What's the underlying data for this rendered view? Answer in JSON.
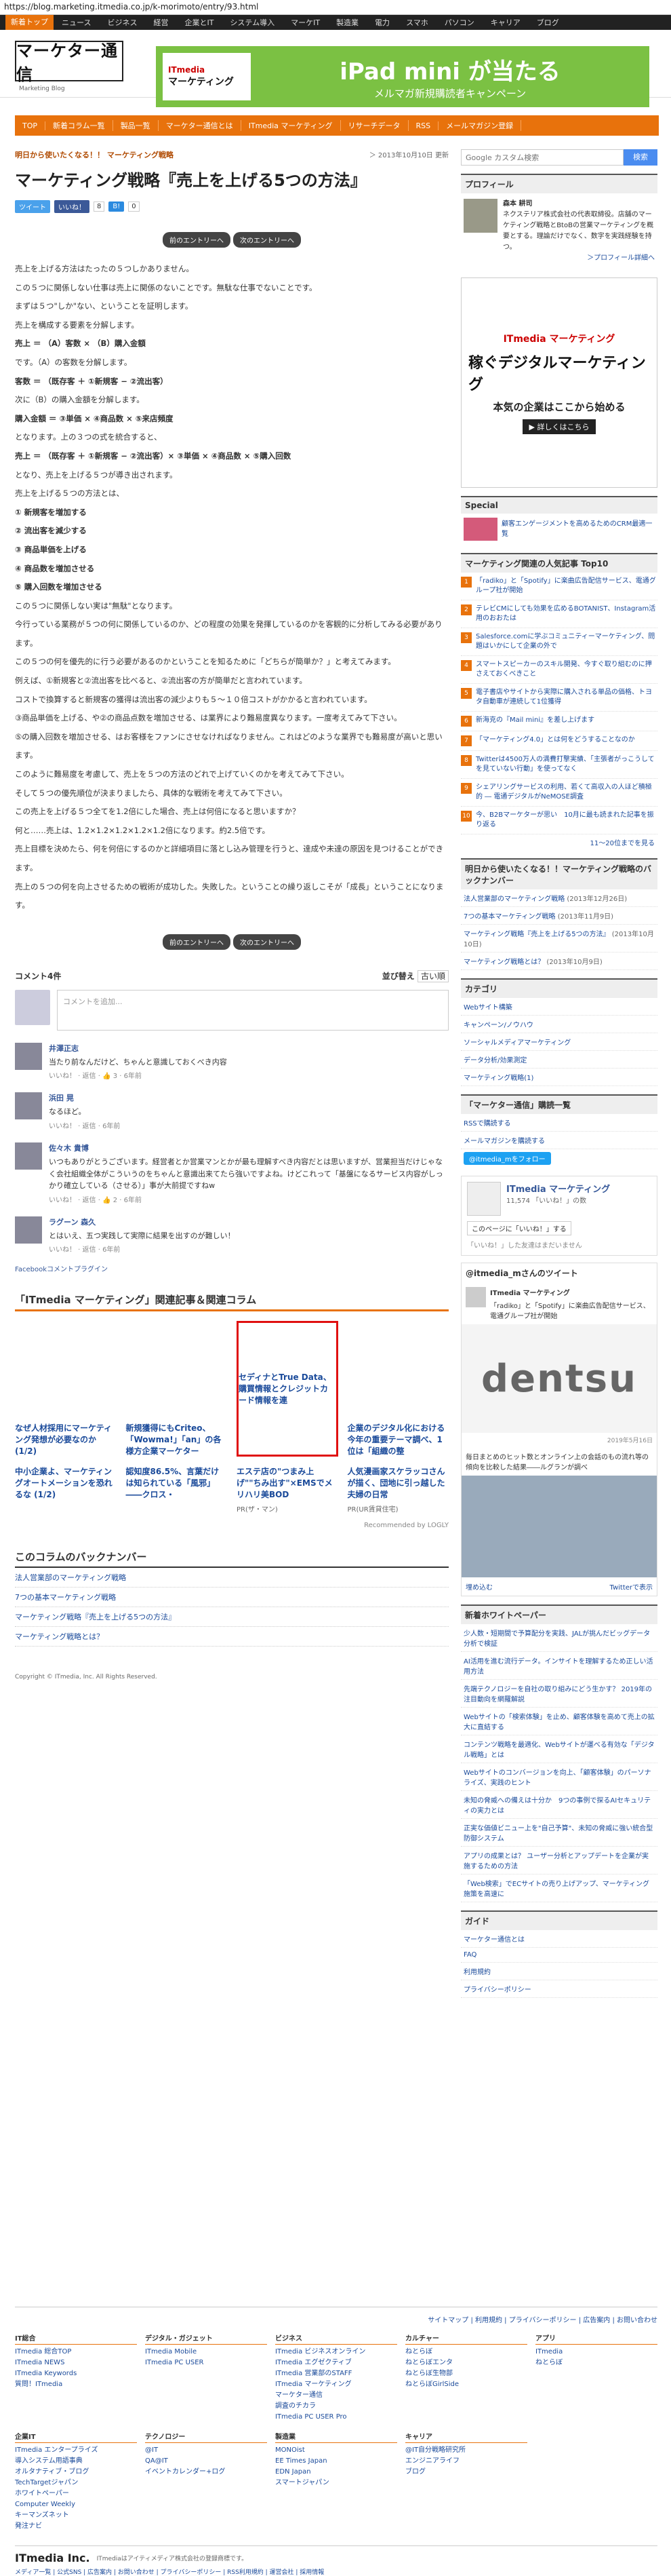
{
  "url": "https://blog.marketing.itmedia.co.jp/k-morimoto/entry/93.html",
  "topnav": [
    "新着トップ",
    "ニュース",
    "ビジネス",
    "経営",
    "企業とIT",
    "システム導入",
    "マーケIT",
    "製造業",
    "電力",
    "スマホ",
    "パソコン",
    "キャリア",
    "ブログ"
  ],
  "logo": {
    "text": "マーケター通信",
    "sub": "Marketing Blog"
  },
  "banner": {
    "brand_top": "ITmedia",
    "brand": "マーケティング",
    "line1": "iPad mini が当たる",
    "line2": "メルマガ新規購読者キャンペーン"
  },
  "catnav": [
    "TOP",
    "新着コラム一覧",
    "製品一覧",
    "マーケター通信とは",
    "ITmedia マーケティング",
    "リサーチデータ",
    "RSS",
    "メールマガジン登録"
  ],
  "article": {
    "crumb": "明日から使いたくなる！！ マーケティング戦略",
    "date": "＞ 2013年10月10日 更新",
    "title": "マーケティング戦略『売上を上げる5つの方法』",
    "tweet": "ツイート",
    "like": "いいね！",
    "like_count": "8",
    "hatena": "B!",
    "hatena_count": "0",
    "prev": "前のエントリーへ",
    "next": "次のエントリーへ",
    "paragraphs": [
      "売上を上げる方法はたったの５つしかありません。",
      "この５つに関係しない仕事は売上に関係のないことです。無駄な仕事でないことです。",
      "まずは５つ\"しか\"ない、ということを証明します。",
      "売上を構成する要素を分解します。",
      "売上 ＝ （A）客数 × （B）購入金額",
      "です。（A）の客数を分解します。",
      "客数 ＝ （既存客 ＋ ①新規客 − ②流出客）",
      "次に（B）の購入金額を分解します。",
      "購入金額 ＝ ③単価 × ④商品数 × ⑤来店頻度",
      "となります。上の３つの式を統合すると、",
      "売上 ＝ （既存客 ＋ ①新規客 − ②流出客）× ③単価 × ④商品数 × ⑤購入回数",
      "となり、売上を上げる５つが導き出されます。",
      "売上を上げる５つの方法とは、",
      "① 新規客を増加する",
      "② 流出客を減少する",
      "③ 商品単価を上げる",
      "④ 商品数を増加させる",
      "⑤ 購入回数を増加させる",
      "この５つに関係しない実は\"無駄\"となります。",
      "今行っている業務が５つの何に関係しているのか、どの程度の効果を発揮しているのかを客観的に分析してみる必要があります。",
      "この５つの何を優先的に行う必要があるのかということを知るために「どちらが簡単か？」と考えてみます。",
      "例えば、①新規客と②流出客を比べると、②流出客の方が簡単だと言われています。",
      "コストで換算すると新規客の獲得は流出客の減少よりも５〜１０倍コストがかかると言われています。",
      "③商品単価を上げる、や②の商品点数を増加させる、は業界により難易度異なります。一度考えてみて下さい。",
      "⑤の購入回数を増加させる、はお客様をファンにさせなければなりません。これはどのような業界でも難易度が高いと思います。",
      "このように難易度を考慮して、売上を５つの方法のどれで上げていくのかを考えてみて下さい。",
      "そして５つの優先順位が決まりましたら、具体的な戦術を考えてみて下さい。",
      "この売上を上げる５つ全てを1.2倍にした場合、売上は何倍になると思いますか？",
      "何と……売上は、1.2×1.2×1.2×1.2×1.2倍になります。約2.5倍です。",
      "売上目標を決めたら、何を何倍にするのかと詳細項目に落とし込み管理を行うと、達成や未達の原因を見つけることができます。",
      "売上の５つの何を向上させるための戦術が成功した。失敗した。ということの繰り返しこそが「成長」ということになります。"
    ]
  },
  "comments": {
    "title": "コメント4件",
    "sort": "並び替え",
    "sort_value": "古い順",
    "placeholder": "コメントを追加...",
    "items": [
      {
        "name": "井澤正志",
        "text": "当たり前なんだけど、ちゃんと意識しておくべき内容",
        "meta": "いいね！ · 返信 · 👍 3 · 6年前"
      },
      {
        "name": "浜田 晃",
        "text": "なるほど。",
        "meta": "いいね！ · 返信 · 6年前"
      },
      {
        "name": "佐々木 貴博",
        "text": "いつもありがとうございます。経営者とか営業マンとかが最も理解すべき内容だとは思いますが、営業担当だけじゃなく会社組織全体がこういうのをちゃんと意識出来てたら強いですよね。けどこれって「基盤になるサービス内容がしっかり確立している（させる）」事が大前提ですねw",
        "meta": "いいね！ · 返信 · 👍 2 · 6年前"
      },
      {
        "name": "ラグーン 森久",
        "text": "とはいえ、五つ実践して実際に結果を出すのが難しい！",
        "meta": "いいね！ · 返信 · 6年前"
      }
    ],
    "plugin": "Facebookコメントプラグイン"
  },
  "related": {
    "title": "「ITmedia マーケティング」関連記事＆関連コラム",
    "row1": [
      "なぜ人材採用にマーケティング発想が必要なのか (1/2)",
      "新規獲得にもCriteo、「Wowma!」「an」の各様方企業マーケター",
      "セディナとTrue Data、購買情報とクレジットカード情報を連",
      "企業のデジタル化における今年の重要テーマ調べ、1位は「組織の整"
    ],
    "row2": [
      {
        "t": "中小企業よ、マーケティングオートメーションを恐れるな (1/2)",
        "pr": ""
      },
      {
        "t": "認知度86.5%、言葉だけは知られている「風邪」――クロス・",
        "pr": ""
      },
      {
        "t": "エステ店の\"つまみ上げ\"\"ちみ出す\"×EMSでメリハリ美BOD",
        "pr": "PR(ザ・マン)"
      },
      {
        "t": "人気漫画家スケラッコさんが描く、団地に引っ越した夫婦の日常",
        "pr": "PR(UR賃貸住宅)"
      }
    ],
    "recommended": "Recommended by LOGLY"
  },
  "backnumber": {
    "title": "このコラムのバックナンバー",
    "items": [
      "法人営業部のマーケティング戦略",
      "7つの基本マーケティング戦略",
      "マーケティング戦略『売上を上げる5つの方法』",
      "マーケティング戦略とは？"
    ]
  },
  "copyright": "Copyright © ITmedia, Inc. All Rights Reserved.",
  "sidebar": {
    "search_placeholder": "Google カスタム検索",
    "search_button": "検索",
    "profile_title": "プロフィール",
    "profile_name": "森本 耕司",
    "profile_text": "ネクステリア株式会社の代表取締役。店舗のマーケティング戦略とBtoBの営業マーケティングを概要とする。理論だけでなく、数字を実践経験を持つ。",
    "profile_link": "＞プロフィール詳細へ",
    "ad_brand": "ITmedia マーケティング",
    "ad_t1": "稼ぐデジタルマーケティング",
    "ad_t2": "本気の企業はここから始める",
    "ad_t3": "▶ 詳しくはこちら",
    "special_title": "Special",
    "special_text": "顧客エンゲージメントを高めるためのCRM最適一覧",
    "ranking_title": "マーケティング関連の人気記事 Top10",
    "ranking": [
      "「radiko」と「Spotify」に楽曲広告配信サービス、電通グループ社が開始",
      "テレビCMにしても効果を広めるBOTANIST、Instagram活用のおおたは",
      "Salesforce.comに学ぶコミュニティーマーケティング、問題はいかにして企業の外で",
      "スマートスピーカーのスキル開発、今すぐ取り組むのに押さえておくべきこと",
      "電子書店やサイトから実際に購入される単品の価格、トヨタ自動車が連続して1位獲得",
      "新海克の『Mail mini』を差し上げます",
      "「マーケティング4.0」とは何をどうすることなのか",
      "Twitterは4500万人の満費打撃実績、「主張者がっこうしてを見ていない行動」を使ってなく",
      "シェアリングサービスの利用、若くて高収入の人ほど積極的 ― 電通デジタルがNeMOSE調査",
      "今、B2Bマーケターが思い　10月に最も読まれた記事を振り返る"
    ],
    "ranking_more": "11〜20位までを見る",
    "latest_title": "明日から使いたくなる！！マーケティング戦略のバックナンバー",
    "latest": [
      {
        "t": "法人営業部のマーケティング戦略",
        "d": "(2013年12月26日)"
      },
      {
        "t": "7つの基本マーケティング戦略",
        "d": "(2013年11月9日)"
      },
      {
        "t": "マーケティング戦略『売上を上げる5つの方法』",
        "d": "(2013年10月10日)"
      },
      {
        "t": "マーケティング戦略とは？",
        "d": "(2013年10月9日)"
      }
    ],
    "category_title": "カテゴリ",
    "categories": [
      "Webサイト構築",
      "キャンペーン/ノウハウ",
      "ソーシャルメディアマーケティング",
      "データ分析/効果測定",
      "マーケティング戦略(1)"
    ],
    "rss_title": "「マーケター通信」購読一覧",
    "rss_items": [
      "RSSで購読する",
      "メールマガジンを購読する"
    ],
    "follow": "@itmedia_mをフォロー",
    "fb_page": "ITmedia マーケティング",
    "fb_likes": "11,574 「いいね！」の数",
    "fb_like_btn": "このページに「いいね！」する",
    "fb_friends": "「いいね！」した友達はまだいません",
    "tweet_title": "@itmedia_mさんのツイート",
    "tweet_name": "ITmedia マーケティング",
    "tweet_text": "「radiko」と「Spotify」に楽曲広告配信サービス、電通グループ社が開始",
    "dentsu": "dentsu",
    "tweet_date": "2019年5月16日",
    "tweet2_text": "毎日まとめのヒット数とオンライン上の会話のもの流れ等の傾向を比較した結果――ルグランが調べ",
    "embed": "埋め込む",
    "twitter_view": "Twitterで表示",
    "whitepaper_title": "新着ホワイトペーパー",
    "whitepapers": [
      "少人数・短期間で予算配分を実践、JALが挑んだビッグデータ分析で検証",
      "AI活用を進む流行データ。インサイトを理解するため正しい活用方法",
      "先端テクノロジーを自社の取り組みにどう生かす？ 2019年の注目動向を網羅解説",
      "Webサイトの「検索体験」を止め、顧客体験を高めて売上の拡大に直結する",
      "コンテンツ戦略を最適化、Webサイトが運べる有効な「デジタル戦略」とは",
      "Webサイトのコンバージョンを向上、「顧客体験」のパーソナライズ、実践のヒント",
      "未知の脅威への備えは十分か　9つの事例で探るAIセキュリティの実力とは",
      "正実な価値ビニュー上を\"自己予算\"、未知の脅威に強い統合型防御システム",
      "アプリの成果とは？ ユーザー分析とアップデートを企業が実施するための方法",
      "「Web検索」でECサイトの売り上げアップ、マーケティング施策を高速に"
    ],
    "guide_title": "ガイド",
    "guides": [
      "マーケター通信とは",
      "FAQ",
      "利用規約",
      "プライバシーポリシー"
    ]
  },
  "footer_links": "サイトマップ | 利用規約 | プライバシーポリシー | 広告案内 | お問い合わせ",
  "footer": [
    {
      "h": "IT総合",
      "l": [
        "ITmedia 総合TOP",
        "ITmedia NEWS",
        "ITmedia Keywords",
        "質問！ITmedia"
      ]
    },
    {
      "h": "デジタル・ガジェット",
      "l": [
        "ITmedia Mobile",
        "ITmedia PC USER"
      ]
    },
    {
      "h": "ビジネス",
      "l": [
        "ITmedia ビジネスオンライン",
        "ITmedia エグゼクティブ",
        "ITmedia 営業部のSTAFF",
        "ITmedia マーケティング",
        "マーケター通信",
        "調査のチカラ",
        "ITmedia PC USER Pro"
      ]
    },
    {
      "h": "カルチャー",
      "l": [
        "ねとらぼ",
        "ねとらぼエンタ",
        "ねとらぼ生物部",
        "ねとらぼGirlSide"
      ]
    },
    {
      "h": "アプリ",
      "l": [
        "ITmedia",
        "ねとらぼ"
      ]
    },
    {
      "h": "企業IT",
      "l": [
        "ITmedia エンタープライズ",
        "導入システム用語事典",
        "オルタナティブ・ブログ",
        "TechTargetジャパン",
        "ホワイトペーパー",
        "Computer Weekly",
        "キーマンズネット",
        "発注ナビ"
      ]
    },
    {
      "h": "テクノロジー",
      "l": [
        "@IT",
        "QA@IT",
        "イベントカレンダー+ログ"
      ]
    },
    {
      "h": "製造業",
      "l": [
        "MONOist",
        "EE Times Japan",
        "EDN Japan",
        "スマートジャパン"
      ]
    },
    {
      "h": "キャリア",
      "l": [
        "@IT自分戦略研究所",
        "エンジニアライフ",
        "ブログ"
      ]
    }
  ],
  "footer_company": "ITmedia Inc.",
  "footer_company_text": "ITmediaはアイティメディア株式会社の登録商標です。",
  "footer_sub": "メディア一覧 | 公式SNS | 広告案内 | お問い合わせ | プライバシーポリシー | RSS利用規約 | 運営会社 | 採用情報"
}
